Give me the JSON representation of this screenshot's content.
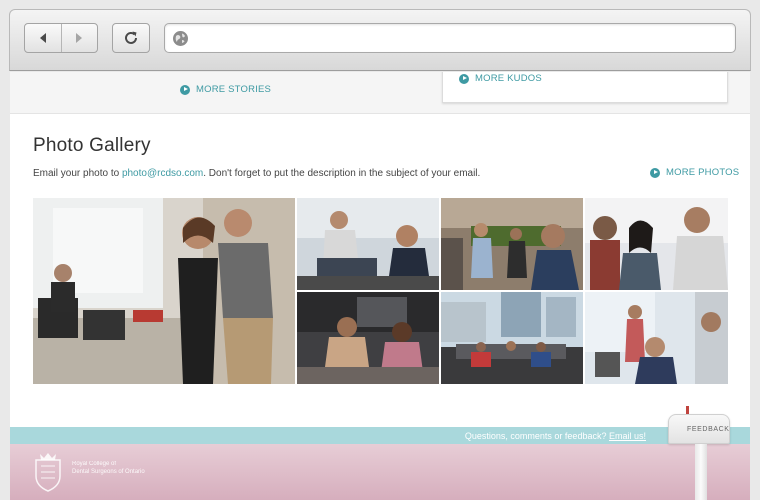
{
  "browser": {
    "back_icon": "back-arrow-icon",
    "forward_icon": "forward-arrow-icon",
    "reload_icon": "reload-icon",
    "globe_icon": "globe-icon",
    "url_value": ""
  },
  "page": {
    "more_stories": "MORE STORIES",
    "more_kudos": "MORE KUDOS",
    "gallery": {
      "title": "Photo Gallery",
      "desc_prefix": "Email your photo to ",
      "email": "photo@rcdso.com",
      "desc_suffix": ". Don't forget to put the description in the subject of your email.",
      "more_photos": "MORE PHOTOS"
    },
    "footer": {
      "question": "Questions, comments or feedback?",
      "email_link": "Email us!",
      "org_line1": "Royal College of",
      "org_line2": "Dental Surgeons of Ontario"
    },
    "feedback_label": "FEEDBACK"
  },
  "colors": {
    "accent": "#3e9aa3",
    "footer_teal": "#a9d8dc",
    "footer_pink": "#d6aebd"
  }
}
